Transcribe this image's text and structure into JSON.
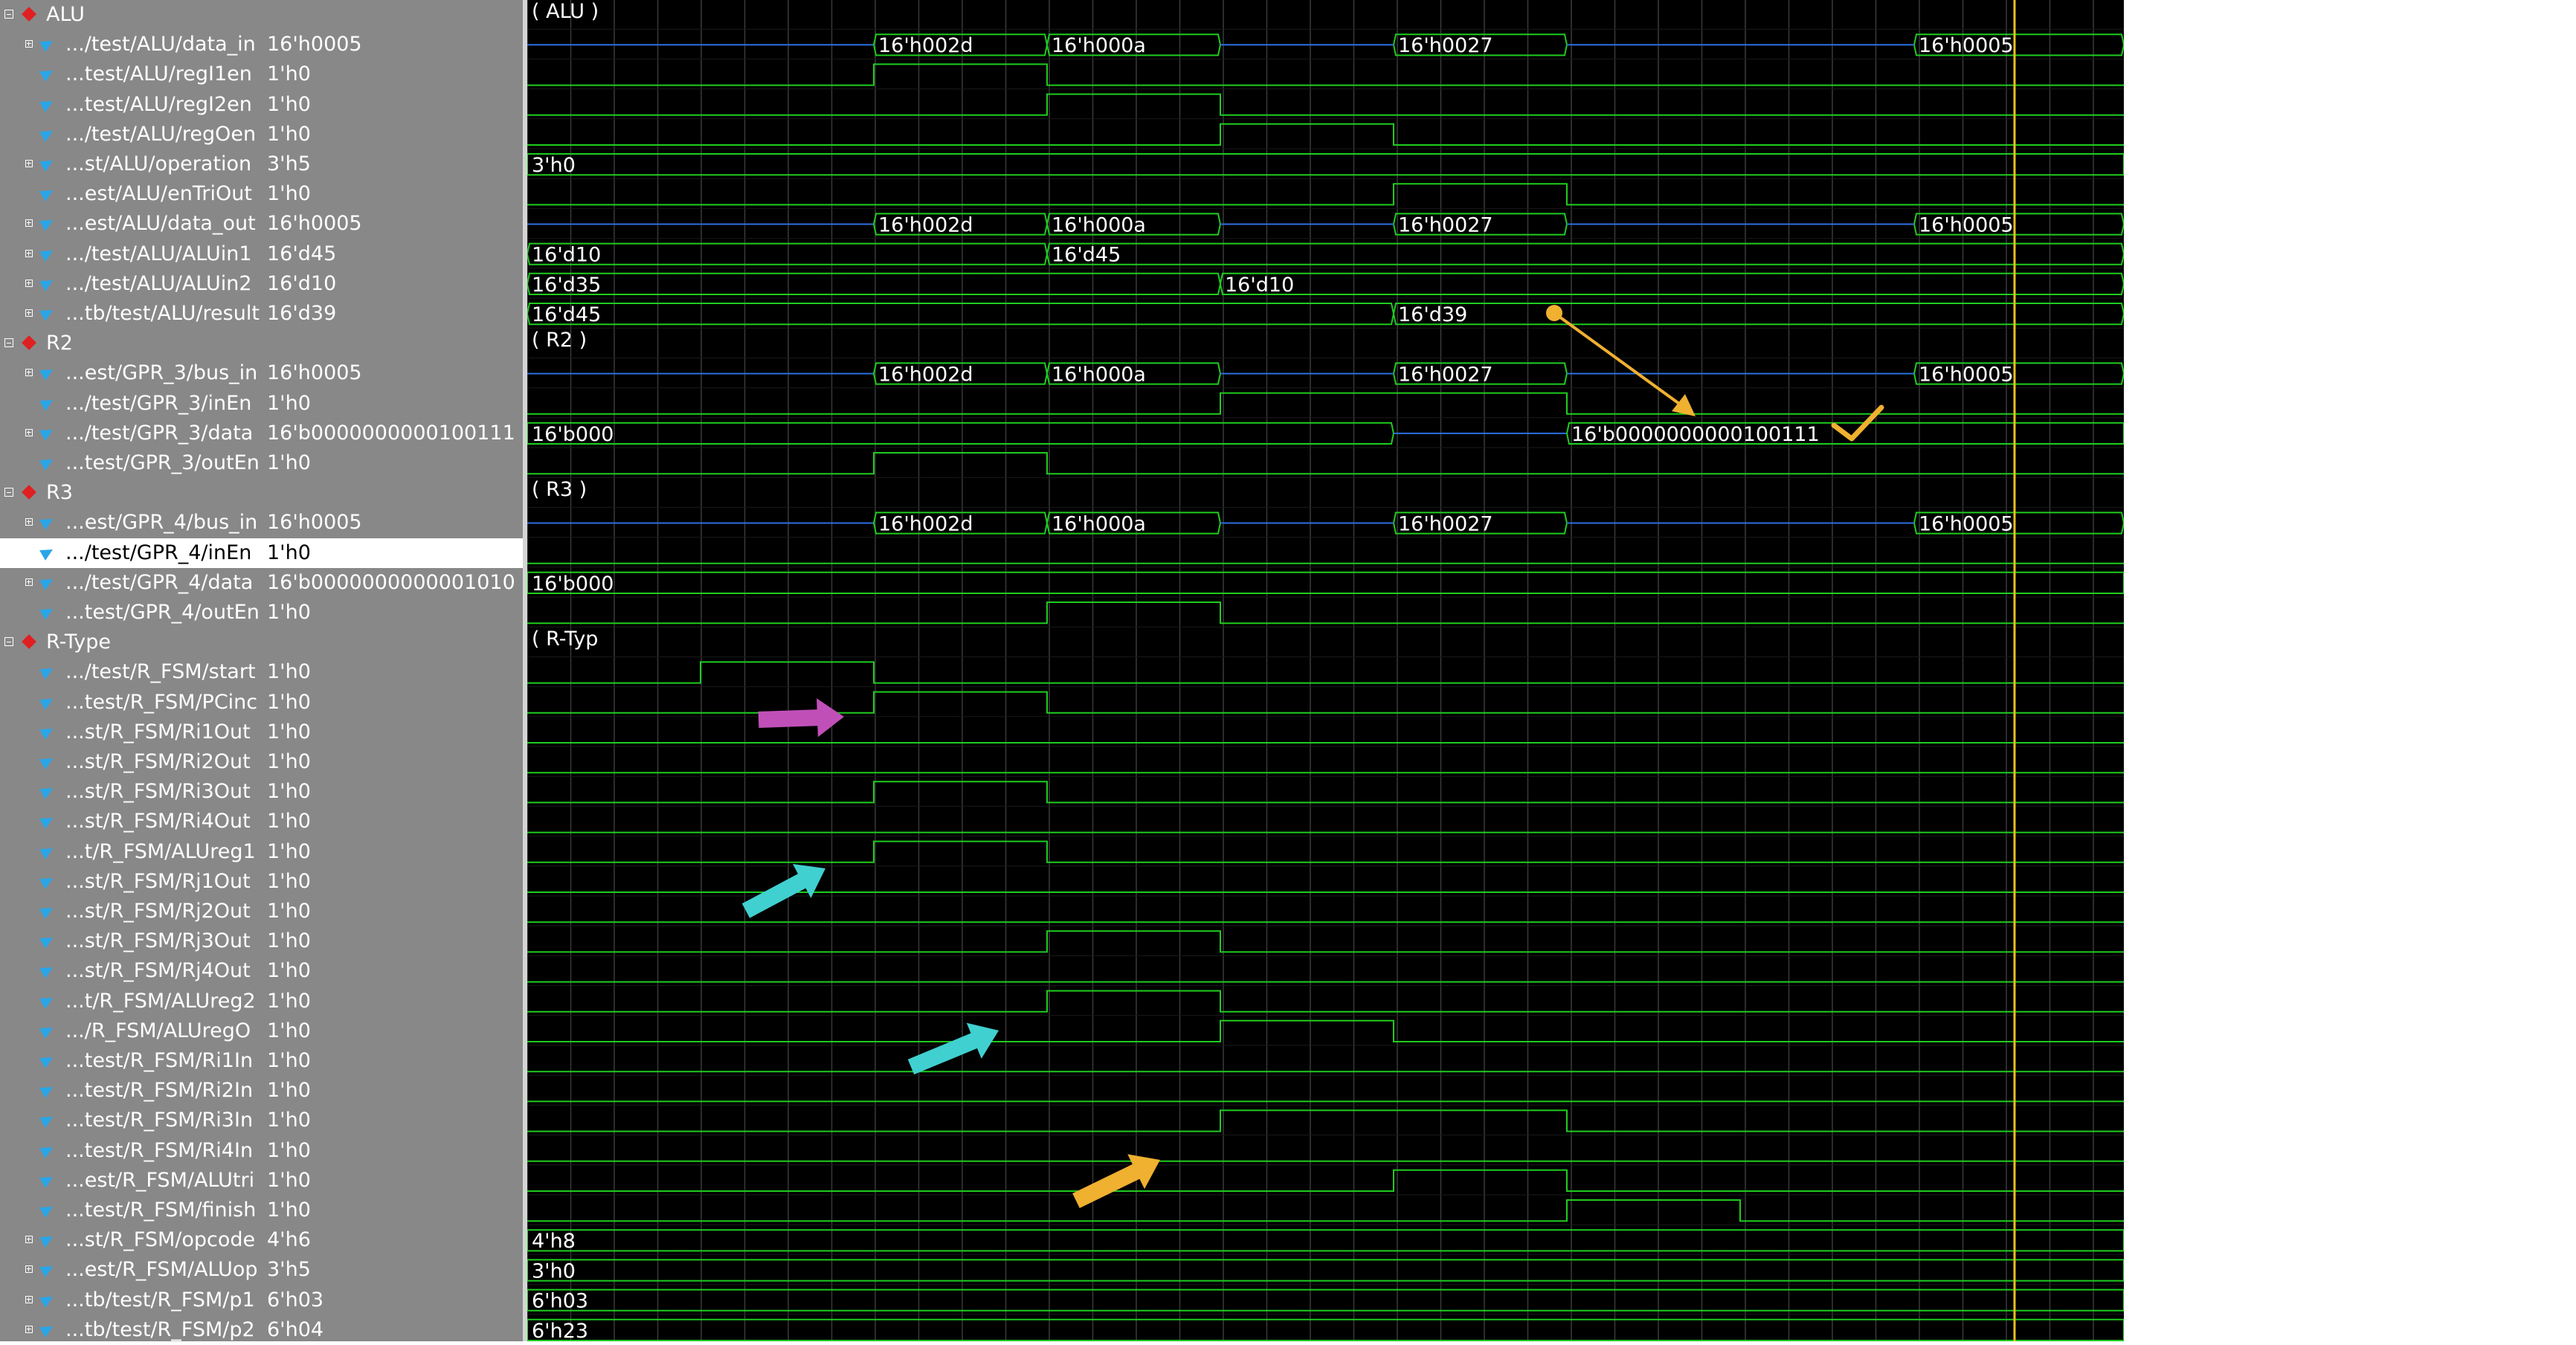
{
  "groups": {
    "alu": "ALU",
    "r2": "R2",
    "r3": "R3",
    "rtype": "R-Type"
  },
  "signals": [
    {
      "kind": "group",
      "name": "ALU"
    },
    {
      "kind": "bus",
      "name": ".../test/ALU/data_in",
      "value": "16'h0005"
    },
    {
      "kind": "bit",
      "name": "...test/ALU/regI1en",
      "value": "1'h0"
    },
    {
      "kind": "bit",
      "name": "...test/ALU/regI2en",
      "value": "1'h0"
    },
    {
      "kind": "bit",
      "name": ".../test/ALU/regOen",
      "value": "1'h0"
    },
    {
      "kind": "bus",
      "name": "...st/ALU/operation",
      "value": "3'h5"
    },
    {
      "kind": "bit",
      "name": "...est/ALU/enTriOut",
      "value": "1'h0"
    },
    {
      "kind": "bus",
      "name": "...est/ALU/data_out",
      "value": "16'h0005"
    },
    {
      "kind": "bus",
      "name": ".../test/ALU/ALUin1",
      "value": "16'd45"
    },
    {
      "kind": "bus",
      "name": ".../test/ALU/ALUin2",
      "value": "16'd10"
    },
    {
      "kind": "bus",
      "name": "...tb/test/ALU/result",
      "value": "16'd39"
    },
    {
      "kind": "group",
      "name": "R2"
    },
    {
      "kind": "bus",
      "name": "...est/GPR_3/bus_in",
      "value": "16'h0005"
    },
    {
      "kind": "bit",
      "name": ".../test/GPR_3/inEn",
      "value": "1'h0"
    },
    {
      "kind": "bus",
      "name": ".../test/GPR_3/data",
      "value": "16'b0000000000100111"
    },
    {
      "kind": "bit",
      "name": "...test/GPR_3/outEn",
      "value": "1'h0"
    },
    {
      "kind": "group",
      "name": "R3"
    },
    {
      "kind": "bus",
      "name": "...est/GPR_4/bus_in",
      "value": "16'h0005"
    },
    {
      "kind": "bit",
      "name": ".../test/GPR_4/inEn",
      "value": "1'h0",
      "selected": true
    },
    {
      "kind": "bus",
      "name": ".../test/GPR_4/data",
      "value": "16'b0000000000001010"
    },
    {
      "kind": "bit",
      "name": "...test/GPR_4/outEn",
      "value": "1'h0"
    },
    {
      "kind": "group",
      "name": "R-Type"
    },
    {
      "kind": "bit",
      "name": ".../test/R_FSM/start",
      "value": "1'h0"
    },
    {
      "kind": "bit",
      "name": "...test/R_FSM/PCinc",
      "value": "1'h0"
    },
    {
      "kind": "bit",
      "name": "...st/R_FSM/Ri1Out",
      "value": "1'h0"
    },
    {
      "kind": "bit",
      "name": "...st/R_FSM/Ri2Out",
      "value": "1'h0"
    },
    {
      "kind": "bit",
      "name": "...st/R_FSM/Ri3Out",
      "value": "1'h0"
    },
    {
      "kind": "bit",
      "name": "...st/R_FSM/Ri4Out",
      "value": "1'h0"
    },
    {
      "kind": "bit",
      "name": "...t/R_FSM/ALUreg1",
      "value": "1'h0"
    },
    {
      "kind": "bit",
      "name": "...st/R_FSM/Rj1Out",
      "value": "1'h0"
    },
    {
      "kind": "bit",
      "name": "...st/R_FSM/Rj2Out",
      "value": "1'h0"
    },
    {
      "kind": "bit",
      "name": "...st/R_FSM/Rj3Out",
      "value": "1'h0"
    },
    {
      "kind": "bit",
      "name": "...st/R_FSM/Rj4Out",
      "value": "1'h0"
    },
    {
      "kind": "bit",
      "name": "...t/R_FSM/ALUreg2",
      "value": "1'h0"
    },
    {
      "kind": "bit",
      "name": ".../R_FSM/ALUregO",
      "value": "1'h0"
    },
    {
      "kind": "bit",
      "name": "...test/R_FSM/Ri1In",
      "value": "1'h0"
    },
    {
      "kind": "bit",
      "name": "...test/R_FSM/Ri2In",
      "value": "1'h0"
    },
    {
      "kind": "bit",
      "name": "...test/R_FSM/Ri3In",
      "value": "1'h0"
    },
    {
      "kind": "bit",
      "name": "...test/R_FSM/Ri4In",
      "value": "1'h0"
    },
    {
      "kind": "bit",
      "name": "...est/R_FSM/ALUtri",
      "value": "1'h0"
    },
    {
      "kind": "bit",
      "name": "...test/R_FSM/finish",
      "value": "1'h0"
    },
    {
      "kind": "bus",
      "name": "...st/R_FSM/opcode",
      "value": "4'h6"
    },
    {
      "kind": "bus",
      "name": "...est/R_FSM/ALUop",
      "value": "3'h5"
    },
    {
      "kind": "bus",
      "name": "...tb/test/R_FSM/p1",
      "value": "6'h03"
    },
    {
      "kind": "bus",
      "name": "...tb/test/R_FSM/p2",
      "value": "6'h04"
    }
  ],
  "waves": {
    "group_labels": [
      "( ALU )",
      "( R2 )",
      "( R3 )",
      "( R-Typ"
    ],
    "data_in": [
      "16'h002d",
      "16'h000a",
      "16'h0027",
      "16'h0005"
    ],
    "operation": "3'h0",
    "data_out": [
      "16'h002d",
      "16'h000a",
      "16'h0027",
      "16'h0005"
    ],
    "aluin1": [
      "16'd10",
      "16'd45"
    ],
    "aluin2": [
      "16'd35",
      "16'd10"
    ],
    "result": [
      "16'd45",
      "16'd39"
    ],
    "gpr3_bus_in": [
      "16'h002d",
      "16'h000a",
      "16'h0027",
      "16'h0005"
    ],
    "gpr3_data": [
      "16'b000",
      "16'b0000000000100111"
    ],
    "gpr4_bus_in": [
      "16'h002d",
      "16'h000a",
      "16'h0027",
      "16'h0005"
    ],
    "gpr4_data": "16'b000",
    "opcode": "4'h8",
    "aluop": "3'h0",
    "p1": "6'h03",
    "p2": "6'h23"
  },
  "annotations": {
    "arrow_magenta_color": "#c050b8",
    "arrow_cyan_color": "#40d0d0",
    "arrow_orange_color": "#f0b030",
    "cursor_color": "#e8c020"
  }
}
